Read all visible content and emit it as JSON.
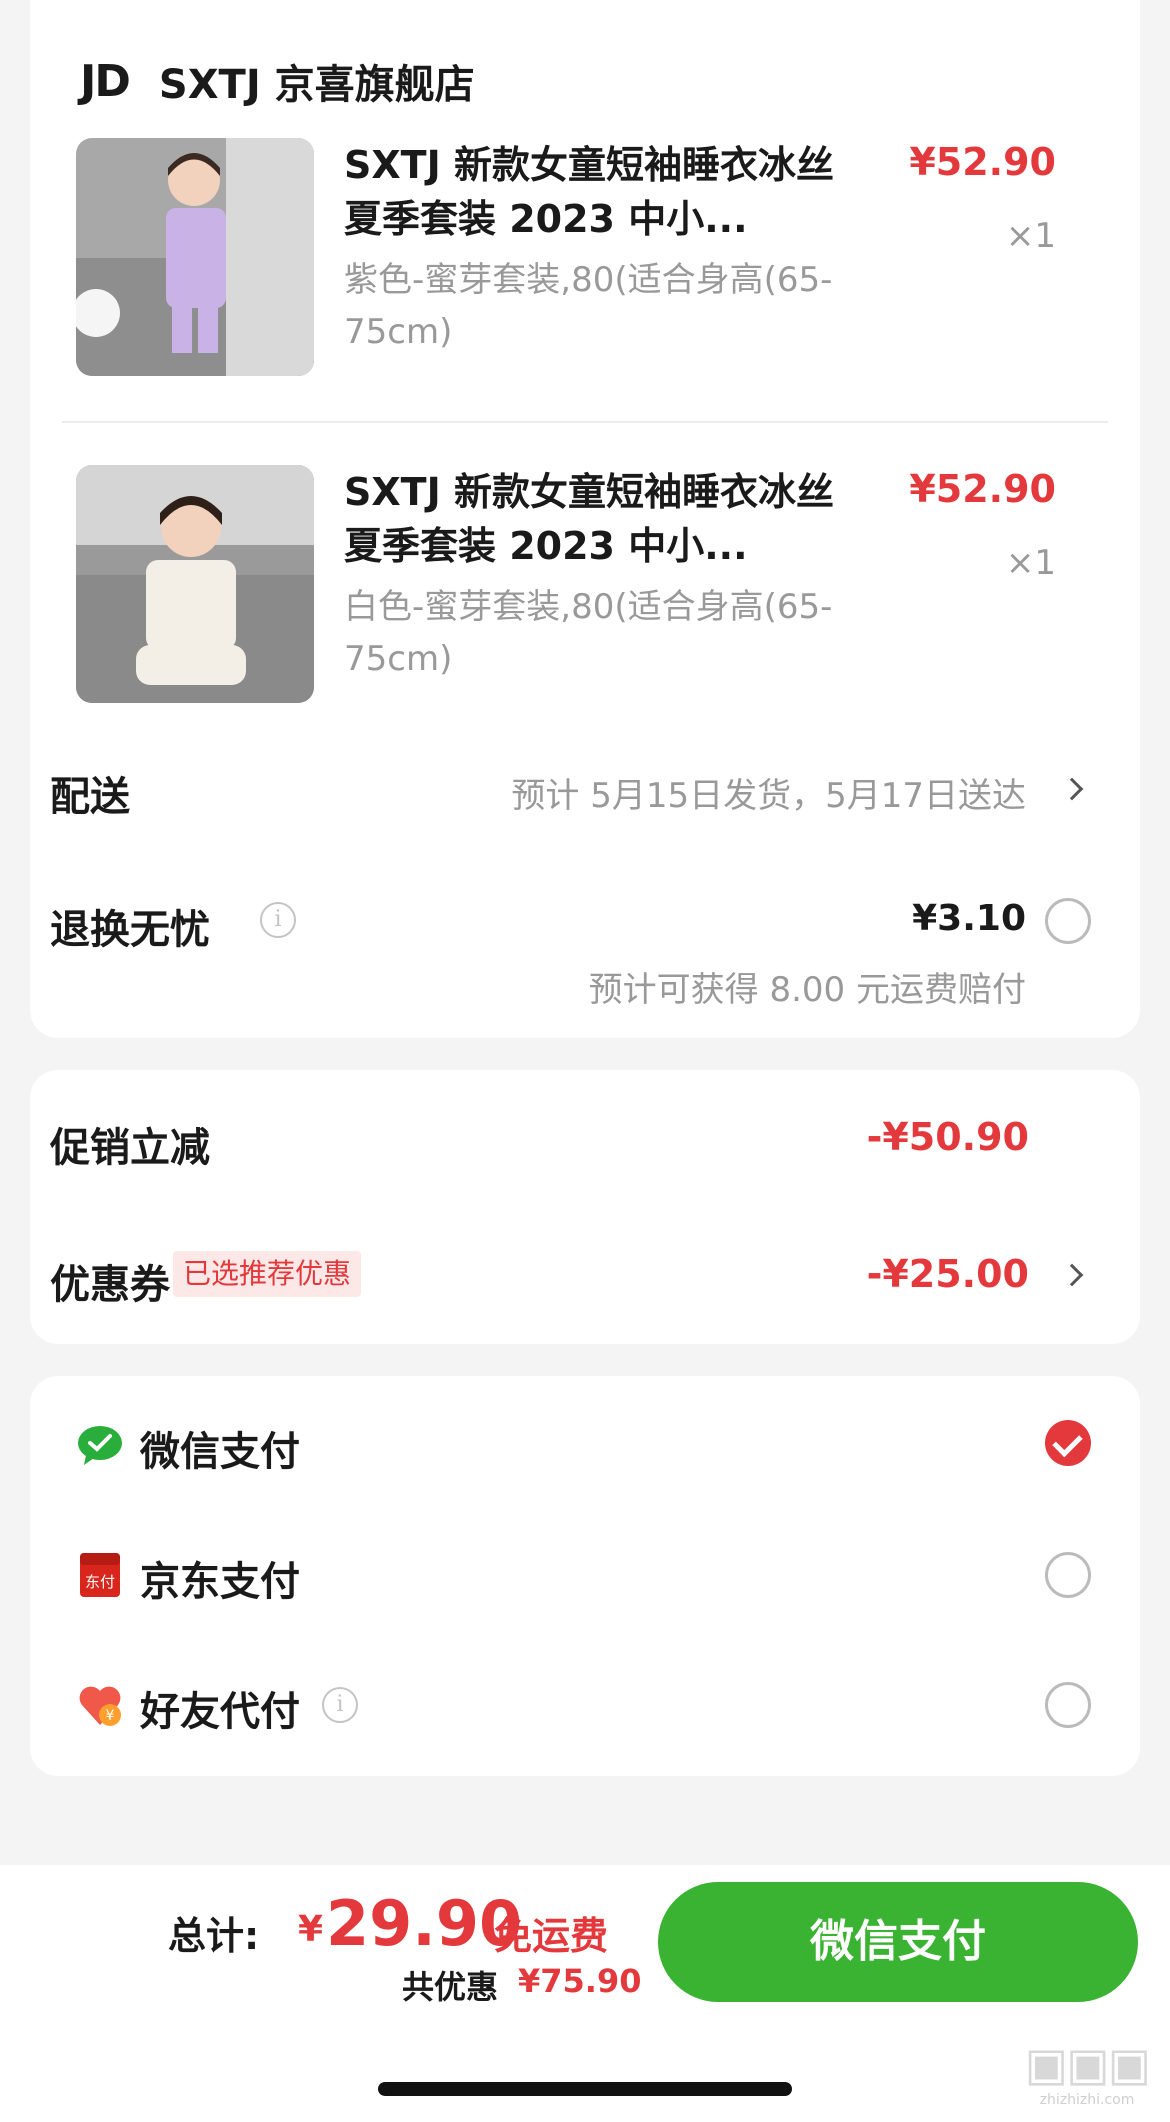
{
  "store": {
    "logo": "JD",
    "name": "SXTJ 京喜旗舰店"
  },
  "products": [
    {
      "title": "SXTJ 新款女童短袖睡衣冰丝夏季套装 2023 中小...",
      "spec": "紫色-蜜芽套装,80(适合身高(65-75cm)",
      "price": "¥52.90",
      "qty": "×1",
      "image_color": "#c9b3e6"
    },
    {
      "title": "SXTJ 新款女童短袖睡衣冰丝夏季套装 2023 中小...",
      "spec": "白色-蜜芽套装,80(适合身高(65-75cm)",
      "price": "¥52.90",
      "qty": "×1",
      "image_color": "#f3efe6"
    }
  ],
  "delivery": {
    "label": "配送",
    "value": "预计 5月15日发货，5月17日送达"
  },
  "return_insurance": {
    "label": "退换无忧",
    "price": "¥3.10",
    "note": "预计可获得 8.00 元运费赔付",
    "checked": false
  },
  "discounts": {
    "promo_label": "促销立减",
    "promo_amount": "-¥50.90",
    "coupon_label": "优惠券",
    "coupon_badge": "已选推荐优惠",
    "coupon_amount": "-¥25.00"
  },
  "payment_methods": [
    {
      "label": "微信支付",
      "icon": "wechat-pay-icon",
      "checked": true
    },
    {
      "label": "京东支付",
      "icon": "jd-pay-icon",
      "checked": false
    },
    {
      "label": "好友代付",
      "icon": "friend-pay-icon",
      "checked": false
    }
  ],
  "footer": {
    "total_label": "总计:",
    "currency": "¥",
    "total_amount": "29.90",
    "free_shipping": "免运费",
    "saved_label": "共优惠",
    "saved_amount": "¥75.90",
    "pay_button": "微信支付"
  },
  "watermark": {
    "text": "zhizhizhi.com"
  },
  "colors": {
    "accent_red": "#e4393c",
    "pay_green": "#3ab332",
    "wechat_green": "#2aae3b"
  }
}
